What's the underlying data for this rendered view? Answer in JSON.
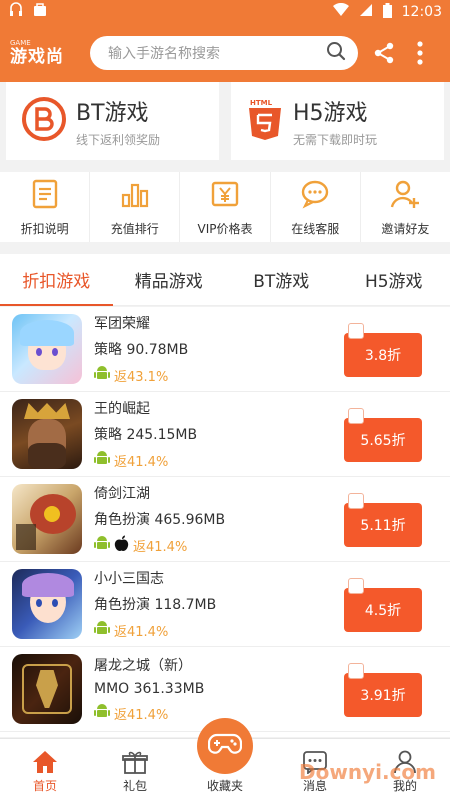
{
  "status": {
    "time": "12:03"
  },
  "header": {
    "logo_text": "游戏尚",
    "logo_sub": "GAME",
    "search_placeholder": "输入手游名称搜索"
  },
  "promo": {
    "bt": {
      "title": "BT游戏",
      "subtitle": "线下返利领奖励"
    },
    "h5": {
      "title": "H5游戏",
      "subtitle": "无需下载即时玩"
    }
  },
  "quick_actions": [
    {
      "label": "折扣说明",
      "icon": "document-icon"
    },
    {
      "label": "充值排行",
      "icon": "bar-chart-icon"
    },
    {
      "label": "VIP价格表",
      "icon": "price-tag-icon"
    },
    {
      "label": "在线客服",
      "icon": "chat-icon"
    },
    {
      "label": "邀请好友",
      "icon": "add-user-icon"
    }
  ],
  "tabs": [
    "折扣游戏",
    "精品游戏",
    "BT游戏",
    "H5游戏"
  ],
  "games": [
    {
      "name": "军团荣耀",
      "meta": "策略 90.78MB",
      "rebate": "返43.1%",
      "discount": "3.8折",
      "platforms": [
        "android"
      ]
    },
    {
      "name": "王的崛起",
      "meta": "策略 245.15MB",
      "rebate": "返41.4%",
      "discount": "5.65折",
      "platforms": [
        "android"
      ]
    },
    {
      "name": "倚剑江湖",
      "meta": "角色扮演 465.96MB",
      "rebate": "返41.4%",
      "discount": "5.11折",
      "platforms": [
        "android",
        "apple"
      ]
    },
    {
      "name": "小小三国志",
      "meta": "角色扮演 118.7MB",
      "rebate": "返41.4%",
      "discount": "4.5折",
      "platforms": [
        "android"
      ]
    },
    {
      "name": "屠龙之城（新）",
      "meta": "MMO 361.33MB",
      "rebate": "返41.4%",
      "discount": "3.91折",
      "platforms": [
        "android"
      ]
    }
  ],
  "bottom_nav": [
    "首页",
    "礼包",
    "收藏夹",
    "消息",
    "我的"
  ],
  "watermark": "Downyi.com",
  "colors": {
    "brand": "#f07a36",
    "accent": "#e8572a",
    "discount_bg": "#f4592b",
    "rebate": "#f0a13a"
  }
}
